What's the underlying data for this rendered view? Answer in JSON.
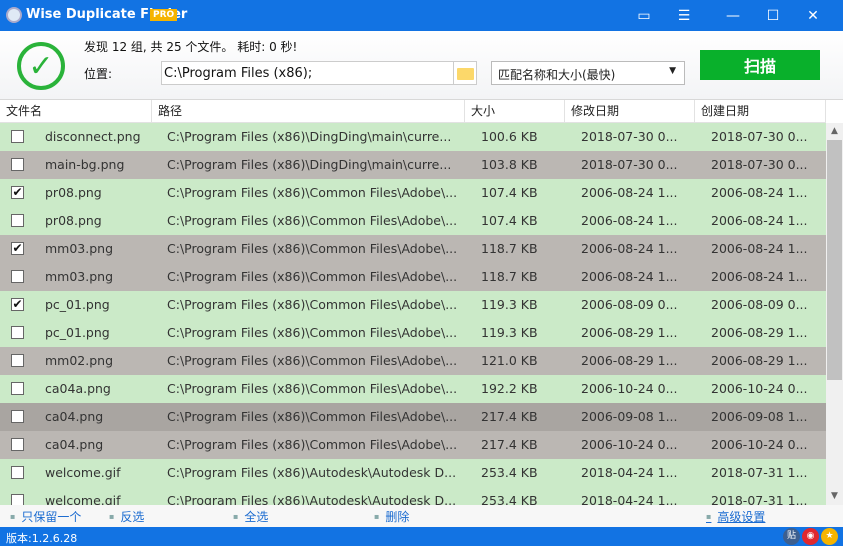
{
  "window": {
    "title": "Wise Duplicate Finder",
    "badge": "PRO"
  },
  "summary": "发现 12 组, 共 25 个文件。 耗时: 0 秒!",
  "location": {
    "label": "位置:",
    "value": "C:\\Program Files (x86);"
  },
  "match_mode": "匹配名称和大小(最快)",
  "scan_label": "扫描",
  "columns": [
    "文件名",
    "路径",
    "大小",
    "修改日期",
    "创建日期"
  ],
  "rows": [
    {
      "name": "disconnect.png",
      "path": "C:\\Program Files (x86)\\DingDing\\main\\curre...",
      "size": "100.6 KB",
      "modified": "2018-07-30 0...",
      "created": "2018-07-30 0...",
      "checked": false,
      "bg": "green"
    },
    {
      "name": "main-bg.png",
      "path": "C:\\Program Files (x86)\\DingDing\\main\\curre...",
      "size": "103.8 KB",
      "modified": "2018-07-30 0...",
      "created": "2018-07-30 0...",
      "checked": false,
      "bg": "gray"
    },
    {
      "name": "pr08.png",
      "path": "C:\\Program Files (x86)\\Common Files\\Adobe\\...",
      "size": "107.4 KB",
      "modified": "2006-08-24 1...",
      "created": "2006-08-24 1...",
      "checked": true,
      "bg": "green"
    },
    {
      "name": "pr08.png",
      "path": "C:\\Program Files (x86)\\Common Files\\Adobe\\...",
      "size": "107.4 KB",
      "modified": "2006-08-24 1...",
      "created": "2006-08-24 1...",
      "checked": false,
      "bg": "green"
    },
    {
      "name": "mm03.png",
      "path": "C:\\Program Files (x86)\\Common Files\\Adobe\\...",
      "size": "118.7 KB",
      "modified": "2006-08-24 1...",
      "created": "2006-08-24 1...",
      "checked": true,
      "bg": "gray"
    },
    {
      "name": "mm03.png",
      "path": "C:\\Program Files (x86)\\Common Files\\Adobe\\...",
      "size": "118.7 KB",
      "modified": "2006-08-24 1...",
      "created": "2006-08-24 1...",
      "checked": false,
      "bg": "gray"
    },
    {
      "name": "pc_01.png",
      "path": "C:\\Program Files (x86)\\Common Files\\Adobe\\...",
      "size": "119.3 KB",
      "modified": "2006-08-09 0...",
      "created": "2006-08-09 0...",
      "checked": true,
      "bg": "green"
    },
    {
      "name": "pc_01.png",
      "path": "C:\\Program Files (x86)\\Common Files\\Adobe\\...",
      "size": "119.3 KB",
      "modified": "2006-08-29 1...",
      "created": "2006-08-29 1...",
      "checked": false,
      "bg": "green"
    },
    {
      "name": "mm02.png",
      "path": "C:\\Program Files (x86)\\Common Files\\Adobe\\...",
      "size": "121.0 KB",
      "modified": "2006-08-29 1...",
      "created": "2006-08-29 1...",
      "checked": false,
      "bg": "gray"
    },
    {
      "name": "ca04a.png",
      "path": "C:\\Program Files (x86)\\Common Files\\Adobe\\...",
      "size": "192.2 KB",
      "modified": "2006-10-24 0...",
      "created": "2006-10-24 0...",
      "checked": false,
      "bg": "green"
    },
    {
      "name": "ca04.png",
      "path": "C:\\Program Files (x86)\\Common Files\\Adobe\\...",
      "size": "217.4 KB",
      "modified": "2006-09-08 1...",
      "created": "2006-09-08 1...",
      "checked": false,
      "bg": "dark"
    },
    {
      "name": "ca04.png",
      "path": "C:\\Program Files (x86)\\Common Files\\Adobe\\...",
      "size": "217.4 KB",
      "modified": "2006-10-24 0...",
      "created": "2006-10-24 0...",
      "checked": false,
      "bg": "gray"
    },
    {
      "name": "welcome.gif",
      "path": "C:\\Program Files (x86)\\Autodesk\\Autodesk D...",
      "size": "253.4 KB",
      "modified": "2018-04-24 1...",
      "created": "2018-07-31 1...",
      "checked": false,
      "bg": "green"
    },
    {
      "name": "welcome.gif",
      "path": "C:\\Program Files (x86)\\Autodesk\\Autodesk D...",
      "size": "253.4 KB",
      "modified": "2018-04-24 1...",
      "created": "2018-07-31 1...",
      "checked": false,
      "bg": "green"
    }
  ],
  "actions": [
    "只保留一个",
    "反选",
    "全选",
    "删除",
    "高级设置"
  ],
  "version": "版本:1.2.6.28",
  "colors": {
    "titlebar": "#1273e3",
    "row_green": "#cbeac8",
    "row_gray": "#bbb7b3",
    "row_dark": "#a9a5a1",
    "scan": "#09b02b"
  }
}
